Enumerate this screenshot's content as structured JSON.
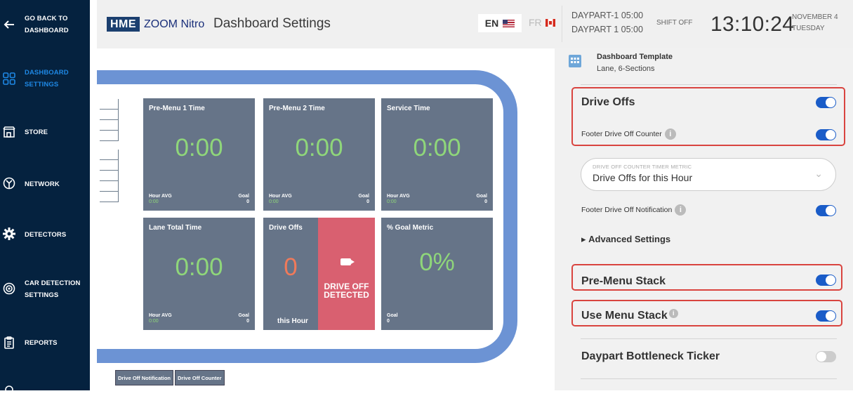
{
  "sidebar": {
    "back_label_1": "GO BACK TO",
    "back_label_2": "DASHBOARD",
    "items": [
      {
        "label_1": "DASHBOARD",
        "label_2": "SETTINGS"
      },
      {
        "label_1": "STORE"
      },
      {
        "label_1": "NETWORK"
      },
      {
        "label_1": "DETECTORS"
      },
      {
        "label_1": "CAR DETECTION",
        "label_2": "SETTINGS"
      },
      {
        "label_1": "REPORTS"
      }
    ]
  },
  "header": {
    "brand": "HME",
    "product": "ZOOM Nitro",
    "title": "Dashboard Settings",
    "lang_en": "EN",
    "lang_fr": "FR",
    "daypart_1": "DAYPART-1 05:00",
    "daypart_2": "DAYPART 1 05:00",
    "shift": "SHIFT OFF",
    "time": "13:10:24",
    "date_1": "NOVEMBER 4",
    "date_2": "TUESDAY"
  },
  "dashboard": {
    "cards": [
      {
        "title": "Pre-Menu 1 Time",
        "value": "0:00",
        "hour_label": "Hour AVG",
        "hour_value": "0:00",
        "goal_label": "Goal",
        "goal_value": "0"
      },
      {
        "title": "Pre-Menu 2 Time",
        "value": "0:00",
        "hour_label": "Hour AVG",
        "hour_value": "0:00",
        "goal_label": "Goal",
        "goal_value": "0"
      },
      {
        "title": "Service Time",
        "value": "0:00",
        "hour_label": "Hour AVG",
        "hour_value": "0:00",
        "goal_label": "Goal",
        "goal_value": "0"
      },
      {
        "title": "Lane Total Time",
        "value": "0:00",
        "hour_label": "Hour AVG",
        "hour_value": "0:00",
        "goal_label": "Goal",
        "goal_value": "0"
      },
      {
        "title": "Drive Offs",
        "value": "0",
        "footer": "this Hour",
        "alert_1": "DRIVE OFF",
        "alert_2": "DETECTED"
      },
      {
        "title": "% Goal Metric",
        "value": "0%",
        "goal_label": "Goal",
        "goal_value": "0"
      }
    ],
    "footer_buttons": [
      "Drive Off Notification",
      "Drive Off Counter"
    ]
  },
  "panel": {
    "template_title": "Dashboard Template",
    "template_sub": "Lane, 6-Sections",
    "drive_offs": "Drive Offs",
    "footer_counter": "Footer Drive Off Counter",
    "dd_label": "DRIVE OFF COUNTER TIMER METRIC",
    "dd_value": "Drive Offs for this Hour",
    "footer_notification": "Footer Drive Off Notification",
    "advanced": "Advanced Settings",
    "pre_menu_stack": "Pre-Menu Stack",
    "use_menu_stack": "Use Menu Stack",
    "bottleneck": "Daypart Bottleneck Ticker"
  }
}
